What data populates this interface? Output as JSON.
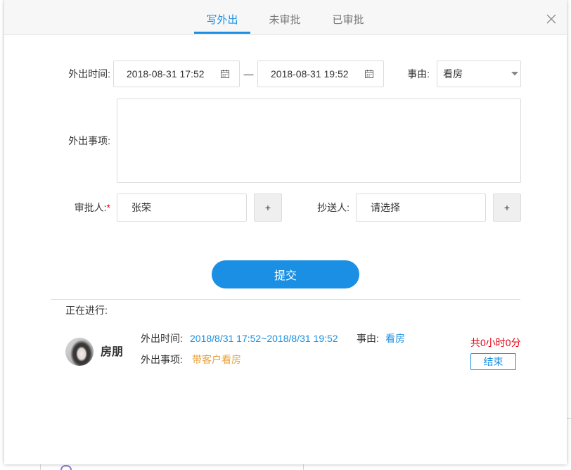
{
  "tabs": [
    {
      "label": "写外出",
      "active": true
    },
    {
      "label": "未审批",
      "active": false
    },
    {
      "label": "已审批",
      "active": false
    }
  ],
  "form": {
    "time_label": "外出时间:",
    "start_time": "2018-08-31 17:52",
    "range_separator": "—",
    "end_time": "2018-08-31 19:52",
    "reason_label": "事由:",
    "reason_value": "看房",
    "matter_label": "外出事项:",
    "approver_label": "审批人:",
    "required_mark": "*",
    "approver_value": "张荣",
    "add_label": "+",
    "cc_label": "抄送人:",
    "cc_value": "请选择",
    "submit_label": "提交"
  },
  "ongoing": {
    "title": "正在进行:",
    "records": [
      {
        "name": "房朋",
        "time_label": "外出时间:",
        "time_value": "2018/8/31 17:52~2018/8/31 19:52",
        "reason_label": "事由:",
        "reason_value": "看房",
        "matter_label": "外出事项:",
        "matter_value": "带客户看房",
        "duration": "共0小时0分",
        "end_label": "结束"
      }
    ]
  },
  "icons": {
    "close": "close-icon",
    "calendar": "calendar-icon",
    "select_caret": "caret-down-icon",
    "avatar": "user-avatar-photo"
  },
  "colors": {
    "accent": "#1a8fe3",
    "highlight": "#e6a23c",
    "danger": "#e60012"
  }
}
